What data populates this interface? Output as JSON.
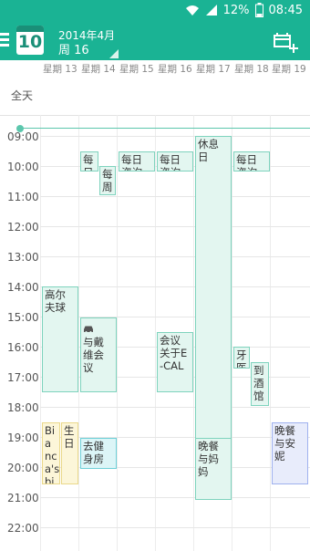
{
  "status": {
    "battery": "12%",
    "time": "08:45"
  },
  "header": {
    "calendar_day": "10",
    "month_line": "2014年4月",
    "week_line": "周 16"
  },
  "days": [
    "星期 13",
    "星期 14",
    "星期 15",
    "星期 16",
    "星期 17",
    "星期 18",
    "星期 19"
  ],
  "allday_label": "全天",
  "hours": [
    "09:00",
    "10:00",
    "11:00",
    "12:00",
    "13:00",
    "14:00",
    "15:00",
    "16:00",
    "17:00",
    "18:00",
    "19:00",
    "20:00",
    "21:00",
    "22:00"
  ],
  "events": {
    "e1": "每日",
    "e2": "每周",
    "e3": "每日咨询",
    "e4": "每日咨询",
    "e5": "休息日",
    "e6": "每日咨询",
    "e7": "高尔夫球",
    "e8": "与戴维会议",
    "e9": "会议关于E-CAL",
    "e10": "牙医",
    "e11": "到酒馆",
    "e12": "Bianca's birthday",
    "e13": "生日",
    "e14": "去健身房",
    "e15": "晚餐与妈妈",
    "e16": "晚餐与安妮"
  },
  "colors": {
    "accent": "#1ab394"
  }
}
